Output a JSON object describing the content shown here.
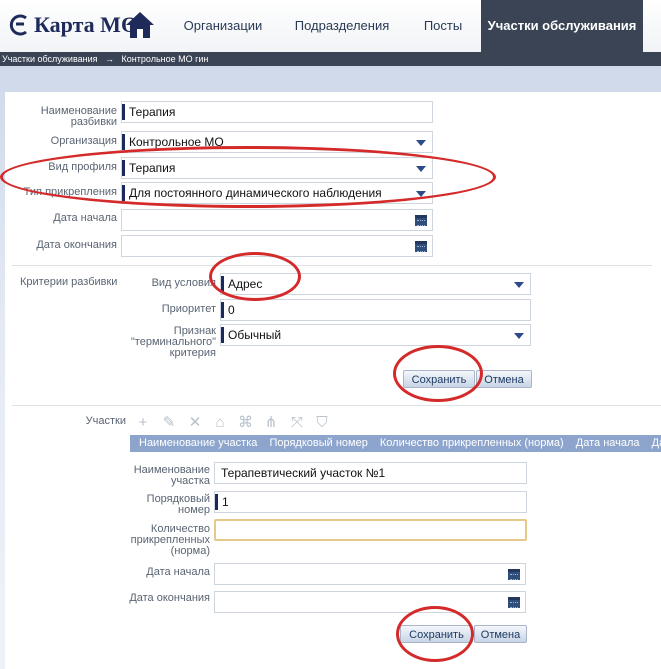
{
  "app": {
    "title": "Карта МО"
  },
  "nav": {
    "tabs": [
      {
        "label": "Организации"
      },
      {
        "label": "Подразделения"
      },
      {
        "label": "Посты"
      },
      {
        "label": "Участки обслуживания"
      }
    ]
  },
  "breadcrumb": {
    "items": [
      "Участки обслуживания",
      "Контрольное МО гин"
    ],
    "separator": "→"
  },
  "form": {
    "name": {
      "label": "Наименование разбивки",
      "value": "Терапия"
    },
    "organization": {
      "label": "Организация",
      "value": "Контрольное МО"
    },
    "profile": {
      "label": "Вид профиля",
      "value": "Терапия"
    },
    "attachment_type": {
      "label": "Тип прикрепления",
      "value": "Для постоянного динамического наблюдения"
    },
    "start_date": {
      "label": "Дата начала",
      "value": ""
    },
    "end_date": {
      "label": "Дата окончания",
      "value": ""
    }
  },
  "criteria": {
    "section_label": "Критерии разбивки",
    "condition_type": {
      "label": "Вид условия",
      "value": "Адрес"
    },
    "priority": {
      "label": "Приоритет",
      "value": "0"
    },
    "terminal": {
      "label": "Признак \"терминального\" критерия",
      "value": "Обычный"
    },
    "save_label": "Сохранить",
    "cancel_label": "Отмена"
  },
  "plots": {
    "section_label": "Участки",
    "toolbar_icons": [
      "add-icon",
      "edit-icon",
      "delete-icon",
      "home-icon",
      "building-icon",
      "hierarchy-icon",
      "split-icon",
      "shield-icon"
    ],
    "columns": [
      "Наименование участка",
      "Порядковый номер",
      "Количество прикрепленных (норма)",
      "Дата начала",
      "Дата"
    ],
    "name": {
      "label": "Наименование участка",
      "value": "Терапевтический участок №1"
    },
    "number": {
      "label": "Порядковый номер",
      "value": "1"
    },
    "count": {
      "label": "Количество прикрепленных (норма)",
      "value": ""
    },
    "start_date": {
      "label": "Дата начала",
      "value": ""
    },
    "end_date": {
      "label": "Дата окончания",
      "value": ""
    },
    "save_label": "Сохранить",
    "cancel_label": "Отмена"
  },
  "colors": {
    "nav_active": "#3a4455",
    "accent": "#2c4b8a",
    "annotation": "#d42a2a",
    "grid_header": "#8da5cd"
  }
}
